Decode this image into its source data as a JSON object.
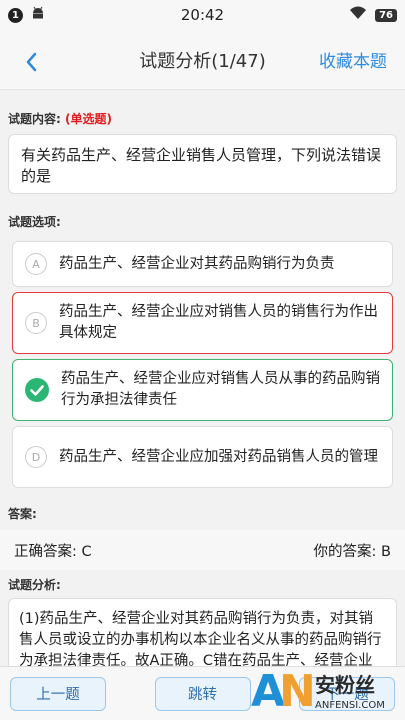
{
  "status_bar": {
    "notification_count": "1",
    "time": "20:42",
    "battery": "76"
  },
  "header": {
    "title": "试题分析(1/47)",
    "favorite_label": "收藏本题"
  },
  "question_section": {
    "label": "试题内容:",
    "type_tag": "(单选题)",
    "text": "有关药品生产、经营企业销售人员管理，下列说法错误的是"
  },
  "options_section": {
    "label": "试题选项:",
    "options": [
      {
        "letter": "A",
        "text": "药品生产、经营企业对其药品购销行为负责",
        "state": "normal"
      },
      {
        "letter": "B",
        "text": "药品生产、经营企业应对销售人员的销售行为作出具体规定",
        "state": "wrong"
      },
      {
        "letter": "C",
        "text": "药品生产、经营企业应对销售人员从事的药品购销行为承担法律责任",
        "state": "correct"
      },
      {
        "letter": "D",
        "text": "药品生产、经营企业应加强对药品销售人员的管理",
        "state": "normal"
      }
    ]
  },
  "answer_section": {
    "label": "答案:",
    "correct_answer": "正确答案: C",
    "your_answer": "你的答案: B"
  },
  "analysis_section": {
    "label": "试题分析:",
    "text": "(1)药品生产、经营企业对其药品购销行为负责，对其销售人员或设立的办事机构以本企业名义从事的药品购销行为承担法律责任。故A正确。C错在药品生产、经营企业"
  },
  "bottom_bar": {
    "prev_label": "上一题",
    "jump_label": "跳转",
    "next_label": "下一题"
  },
  "watermark": {
    "brand": "安粉丝",
    "url": "ANFENSI.COM"
  },
  "colors": {
    "accent": "#2e8bde",
    "wrong": "#e03c3c",
    "correct": "#3cb371",
    "tag_red": "#e02020"
  }
}
